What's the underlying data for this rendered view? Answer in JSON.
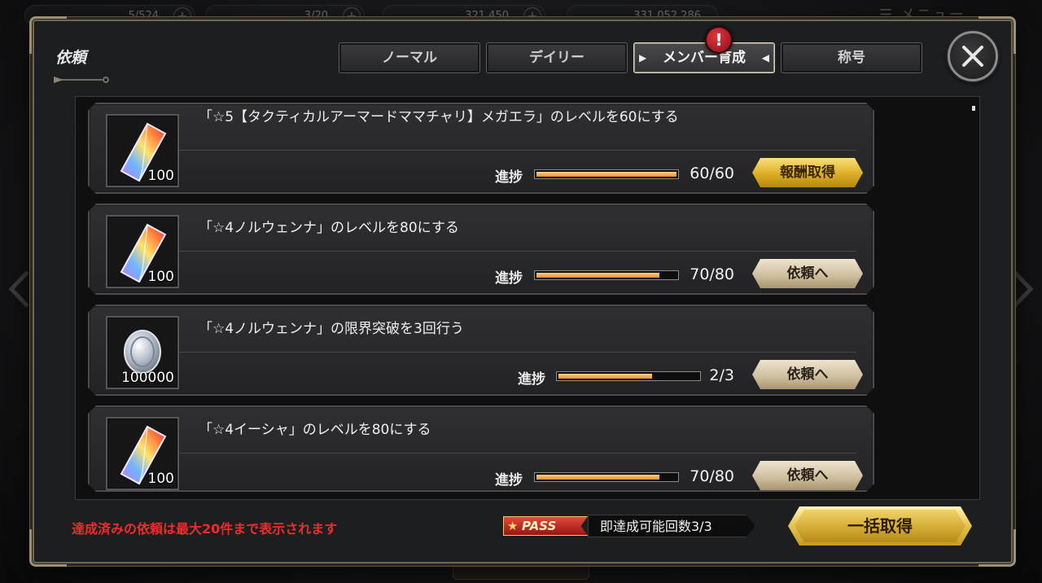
{
  "background": {
    "hud": [
      {
        "value": "5/524",
        "name": "ap-counter"
      },
      {
        "value": "3/20",
        "name": "bp-counter"
      },
      {
        "value": "321,450",
        "name": "currency-counter"
      },
      {
        "value": "331,052,286",
        "name": "gold-counter"
      }
    ],
    "menu_label": "☰ メニュー"
  },
  "dialog": {
    "title": "依頼",
    "tabs": [
      {
        "label": "ノーマル",
        "active": false
      },
      {
        "label": "デイリー",
        "active": false
      },
      {
        "label": "メンバー育成",
        "active": true
      },
      {
        "label": "称号",
        "active": false
      }
    ],
    "alert_mark": "!"
  },
  "quests": [
    {
      "text": "「☆5【タクティカルアーマードママチャリ】メガエラ」のレベルを60にする",
      "reward_icon": "rainbow-crystal-icon",
      "reward_qty": "100",
      "progress_label": "進捗",
      "progress_text": "60/60",
      "progress": 1.0,
      "button": "報酬取得",
      "button_style": "gold"
    },
    {
      "text": "「☆4ノルウェンナ」のレベルを80にする",
      "reward_icon": "rainbow-crystal-icon",
      "reward_qty": "100",
      "progress_label": "進捗",
      "progress_text": "70/80",
      "progress": 0.875,
      "button": "依頼へ",
      "button_style": "beige"
    },
    {
      "text": "「☆4ノルウェンナ」の限界突破を3回行う",
      "reward_icon": "silver-coin-icon",
      "reward_qty": "100000",
      "progress_label": "進捗",
      "progress_text": "2/3",
      "progress": 0.667,
      "button": "依頼へ",
      "button_style": "beige"
    },
    {
      "text": "「☆4イーシャ」のレベルを80にする",
      "reward_icon": "rainbow-crystal-icon",
      "reward_qty": "100",
      "progress_label": "進捗",
      "progress_text": "70/80",
      "progress": 0.875,
      "button": "依頼へ",
      "button_style": "beige"
    }
  ],
  "footer": {
    "note": "達成済みの依頼は最大20件まで表示されます",
    "pass_label": "PASS",
    "pass_count_text": "即達成可能回数3/3",
    "bulk_button": "一括取得"
  },
  "colors": {
    "note_red": "#ef2b2b",
    "progress_fill": "#e98f2e",
    "gold_button": "#dcae25",
    "beige_button": "#cdbd9c"
  }
}
